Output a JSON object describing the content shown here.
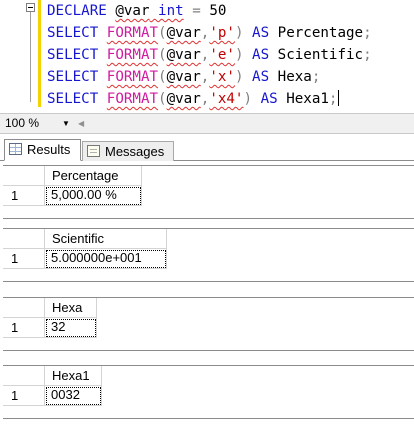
{
  "editor": {
    "lines": [
      [
        [
          "DECLARE ",
          "kw"
        ],
        [
          "@var",
          "vr sq"
        ],
        [
          " int",
          "kw sq"
        ],
        [
          " = ",
          "gr"
        ],
        [
          "50",
          "vr"
        ]
      ],
      [
        [
          "SELECT ",
          "kw"
        ],
        [
          "FORMAT",
          "fn sq"
        ],
        [
          "(",
          "gr"
        ],
        [
          "@var",
          "vr sq"
        ],
        [
          ",",
          "gr"
        ],
        [
          "'p'",
          "str sq"
        ],
        [
          ")",
          "gr"
        ],
        [
          " AS ",
          "kw"
        ],
        [
          "Percentage",
          "vr"
        ],
        [
          ";",
          "gr"
        ]
      ],
      [
        [
          "SELECT ",
          "kw"
        ],
        [
          "FORMAT",
          "fn sq"
        ],
        [
          "(",
          "gr"
        ],
        [
          "@var",
          "vr sq"
        ],
        [
          ",",
          "gr"
        ],
        [
          "'e'",
          "str sq"
        ],
        [
          ")",
          "gr"
        ],
        [
          " AS ",
          "kw"
        ],
        [
          "Scientific",
          "vr"
        ],
        [
          ";",
          "gr"
        ]
      ],
      [
        [
          "SELECT ",
          "kw"
        ],
        [
          "FORMAT",
          "fn sq"
        ],
        [
          "(",
          "gr"
        ],
        [
          "@var",
          "vr sq"
        ],
        [
          ",",
          "gr"
        ],
        [
          "'x'",
          "str sq"
        ],
        [
          ")",
          "gr"
        ],
        [
          " AS ",
          "kw"
        ],
        [
          "Hexa",
          "vr"
        ],
        [
          ";",
          "gr"
        ]
      ],
      [
        [
          "SELECT ",
          "kw"
        ],
        [
          "FORMAT",
          "fn sq"
        ],
        [
          "(",
          "gr"
        ],
        [
          "@var",
          "vr sq"
        ],
        [
          ",",
          "gr"
        ],
        [
          "'x4'",
          "str sq"
        ],
        [
          ")",
          "gr"
        ],
        [
          " AS ",
          "kw"
        ],
        [
          "Hexa1",
          "vr"
        ],
        [
          ";",
          "gr"
        ]
      ]
    ]
  },
  "zoom": {
    "value": "100 %"
  },
  "tabs": {
    "results": "Results",
    "messages": "Messages"
  },
  "grids": [
    {
      "column": "Percentage",
      "row_num": "1",
      "value": "5,000.00 %"
    },
    {
      "column": "Scientific",
      "row_num": "1",
      "value": "5.000000e+001"
    },
    {
      "column": "Hexa",
      "row_num": "1",
      "value": "32"
    },
    {
      "column": "Hexa1",
      "row_num": "1",
      "value": "0032"
    }
  ],
  "icons": {
    "zoom_dropdown": "chevron-down-icon",
    "scroll_left": "arrow-left-icon",
    "results_tab": "grid-icon",
    "messages_tab": "messages-icon",
    "collapse": "collapse-icon"
  },
  "colors": {
    "keyword": "#1616d0",
    "function": "#d01aa0",
    "string": "#c00000",
    "operator": "#808080",
    "squiggle": "#e03030",
    "change_bar": "#f2d200"
  }
}
